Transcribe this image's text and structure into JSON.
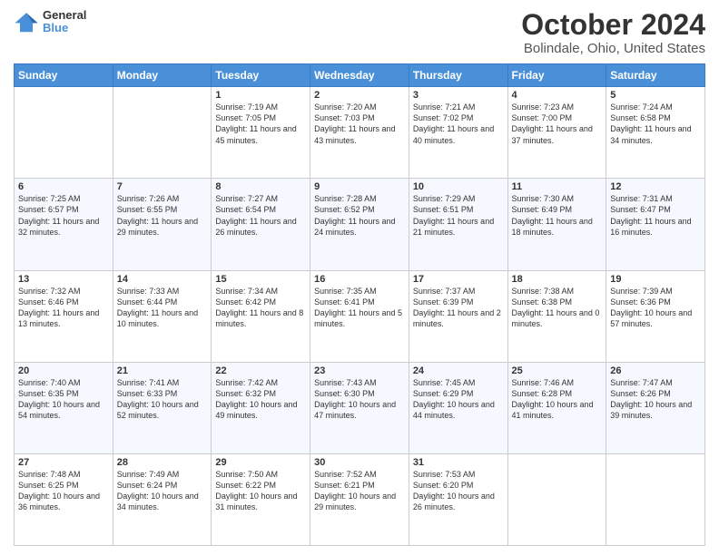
{
  "header": {
    "logo_line1": "General",
    "logo_line2": "Blue",
    "title": "October 2024",
    "subtitle": "Bolindale, Ohio, United States"
  },
  "days_of_week": [
    "Sunday",
    "Monday",
    "Tuesday",
    "Wednesday",
    "Thursday",
    "Friday",
    "Saturday"
  ],
  "weeks": [
    [
      {
        "day": "",
        "sunrise": "",
        "sunset": "",
        "daylight": ""
      },
      {
        "day": "",
        "sunrise": "",
        "sunset": "",
        "daylight": ""
      },
      {
        "day": "1",
        "sunrise": "Sunrise: 7:19 AM",
        "sunset": "Sunset: 7:05 PM",
        "daylight": "Daylight: 11 hours and 45 minutes."
      },
      {
        "day": "2",
        "sunrise": "Sunrise: 7:20 AM",
        "sunset": "Sunset: 7:03 PM",
        "daylight": "Daylight: 11 hours and 43 minutes."
      },
      {
        "day": "3",
        "sunrise": "Sunrise: 7:21 AM",
        "sunset": "Sunset: 7:02 PM",
        "daylight": "Daylight: 11 hours and 40 minutes."
      },
      {
        "day": "4",
        "sunrise": "Sunrise: 7:23 AM",
        "sunset": "Sunset: 7:00 PM",
        "daylight": "Daylight: 11 hours and 37 minutes."
      },
      {
        "day": "5",
        "sunrise": "Sunrise: 7:24 AM",
        "sunset": "Sunset: 6:58 PM",
        "daylight": "Daylight: 11 hours and 34 minutes."
      }
    ],
    [
      {
        "day": "6",
        "sunrise": "Sunrise: 7:25 AM",
        "sunset": "Sunset: 6:57 PM",
        "daylight": "Daylight: 11 hours and 32 minutes."
      },
      {
        "day": "7",
        "sunrise": "Sunrise: 7:26 AM",
        "sunset": "Sunset: 6:55 PM",
        "daylight": "Daylight: 11 hours and 29 minutes."
      },
      {
        "day": "8",
        "sunrise": "Sunrise: 7:27 AM",
        "sunset": "Sunset: 6:54 PM",
        "daylight": "Daylight: 11 hours and 26 minutes."
      },
      {
        "day": "9",
        "sunrise": "Sunrise: 7:28 AM",
        "sunset": "Sunset: 6:52 PM",
        "daylight": "Daylight: 11 hours and 24 minutes."
      },
      {
        "day": "10",
        "sunrise": "Sunrise: 7:29 AM",
        "sunset": "Sunset: 6:51 PM",
        "daylight": "Daylight: 11 hours and 21 minutes."
      },
      {
        "day": "11",
        "sunrise": "Sunrise: 7:30 AM",
        "sunset": "Sunset: 6:49 PM",
        "daylight": "Daylight: 11 hours and 18 minutes."
      },
      {
        "day": "12",
        "sunrise": "Sunrise: 7:31 AM",
        "sunset": "Sunset: 6:47 PM",
        "daylight": "Daylight: 11 hours and 16 minutes."
      }
    ],
    [
      {
        "day": "13",
        "sunrise": "Sunrise: 7:32 AM",
        "sunset": "Sunset: 6:46 PM",
        "daylight": "Daylight: 11 hours and 13 minutes."
      },
      {
        "day": "14",
        "sunrise": "Sunrise: 7:33 AM",
        "sunset": "Sunset: 6:44 PM",
        "daylight": "Daylight: 11 hours and 10 minutes."
      },
      {
        "day": "15",
        "sunrise": "Sunrise: 7:34 AM",
        "sunset": "Sunset: 6:42 PM",
        "daylight": "Daylight: 11 hours and 8 minutes."
      },
      {
        "day": "16",
        "sunrise": "Sunrise: 7:35 AM",
        "sunset": "Sunset: 6:41 PM",
        "daylight": "Daylight: 11 hours and 5 minutes."
      },
      {
        "day": "17",
        "sunrise": "Sunrise: 7:37 AM",
        "sunset": "Sunset: 6:39 PM",
        "daylight": "Daylight: 11 hours and 2 minutes."
      },
      {
        "day": "18",
        "sunrise": "Sunrise: 7:38 AM",
        "sunset": "Sunset: 6:38 PM",
        "daylight": "Daylight: 11 hours and 0 minutes."
      },
      {
        "day": "19",
        "sunrise": "Sunrise: 7:39 AM",
        "sunset": "Sunset: 6:36 PM",
        "daylight": "Daylight: 10 hours and 57 minutes."
      }
    ],
    [
      {
        "day": "20",
        "sunrise": "Sunrise: 7:40 AM",
        "sunset": "Sunset: 6:35 PM",
        "daylight": "Daylight: 10 hours and 54 minutes."
      },
      {
        "day": "21",
        "sunrise": "Sunrise: 7:41 AM",
        "sunset": "Sunset: 6:33 PM",
        "daylight": "Daylight: 10 hours and 52 minutes."
      },
      {
        "day": "22",
        "sunrise": "Sunrise: 7:42 AM",
        "sunset": "Sunset: 6:32 PM",
        "daylight": "Daylight: 10 hours and 49 minutes."
      },
      {
        "day": "23",
        "sunrise": "Sunrise: 7:43 AM",
        "sunset": "Sunset: 6:30 PM",
        "daylight": "Daylight: 10 hours and 47 minutes."
      },
      {
        "day": "24",
        "sunrise": "Sunrise: 7:45 AM",
        "sunset": "Sunset: 6:29 PM",
        "daylight": "Daylight: 10 hours and 44 minutes."
      },
      {
        "day": "25",
        "sunrise": "Sunrise: 7:46 AM",
        "sunset": "Sunset: 6:28 PM",
        "daylight": "Daylight: 10 hours and 41 minutes."
      },
      {
        "day": "26",
        "sunrise": "Sunrise: 7:47 AM",
        "sunset": "Sunset: 6:26 PM",
        "daylight": "Daylight: 10 hours and 39 minutes."
      }
    ],
    [
      {
        "day": "27",
        "sunrise": "Sunrise: 7:48 AM",
        "sunset": "Sunset: 6:25 PM",
        "daylight": "Daylight: 10 hours and 36 minutes."
      },
      {
        "day": "28",
        "sunrise": "Sunrise: 7:49 AM",
        "sunset": "Sunset: 6:24 PM",
        "daylight": "Daylight: 10 hours and 34 minutes."
      },
      {
        "day": "29",
        "sunrise": "Sunrise: 7:50 AM",
        "sunset": "Sunset: 6:22 PM",
        "daylight": "Daylight: 10 hours and 31 minutes."
      },
      {
        "day": "30",
        "sunrise": "Sunrise: 7:52 AM",
        "sunset": "Sunset: 6:21 PM",
        "daylight": "Daylight: 10 hours and 29 minutes."
      },
      {
        "day": "31",
        "sunrise": "Sunrise: 7:53 AM",
        "sunset": "Sunset: 6:20 PM",
        "daylight": "Daylight: 10 hours and 26 minutes."
      },
      {
        "day": "",
        "sunrise": "",
        "sunset": "",
        "daylight": ""
      },
      {
        "day": "",
        "sunrise": "",
        "sunset": "",
        "daylight": ""
      }
    ]
  ]
}
